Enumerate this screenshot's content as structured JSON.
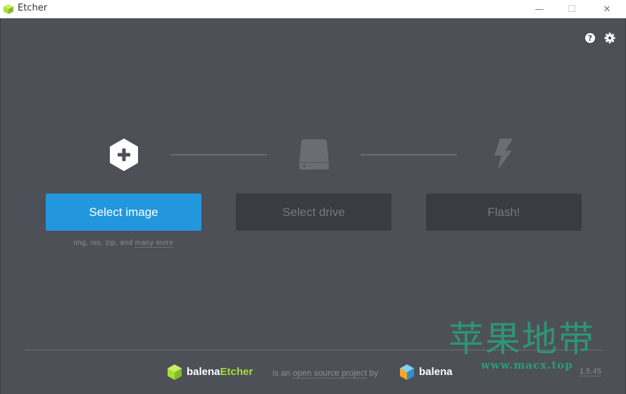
{
  "window": {
    "title": "Etcher",
    "minimize_glyph": "—",
    "maximize_glyph": "☐",
    "close_glyph": "✕"
  },
  "header": {
    "help_icon": "help-icon",
    "settings_icon": "gear-icon"
  },
  "steps": {
    "select_image": {
      "label": "Select image",
      "icon": "plus-icon"
    },
    "select_drive": {
      "label": "Select drive",
      "icon": "drive-icon"
    },
    "flash": {
      "label": "Flash!",
      "icon": "lightning-icon"
    },
    "formats_prefix": "img, iso, zip, and ",
    "formats_link": "many more"
  },
  "footer": {
    "brand_prefix": "balena",
    "brand_suffix": "Etcher",
    "oss_prefix": "is an ",
    "oss_link": "open source project",
    "oss_suffix": " by",
    "company": "balena",
    "version": "1.5.45"
  },
  "watermark": {
    "chinese": "苹果地带",
    "url": "www.macx.top"
  },
  "colors": {
    "background": "#4d5057",
    "accent": "#2297de",
    "disabled_button": "#3a3c41",
    "etcher_green": "#a5de37",
    "watermark_green": "#2a9d77"
  }
}
